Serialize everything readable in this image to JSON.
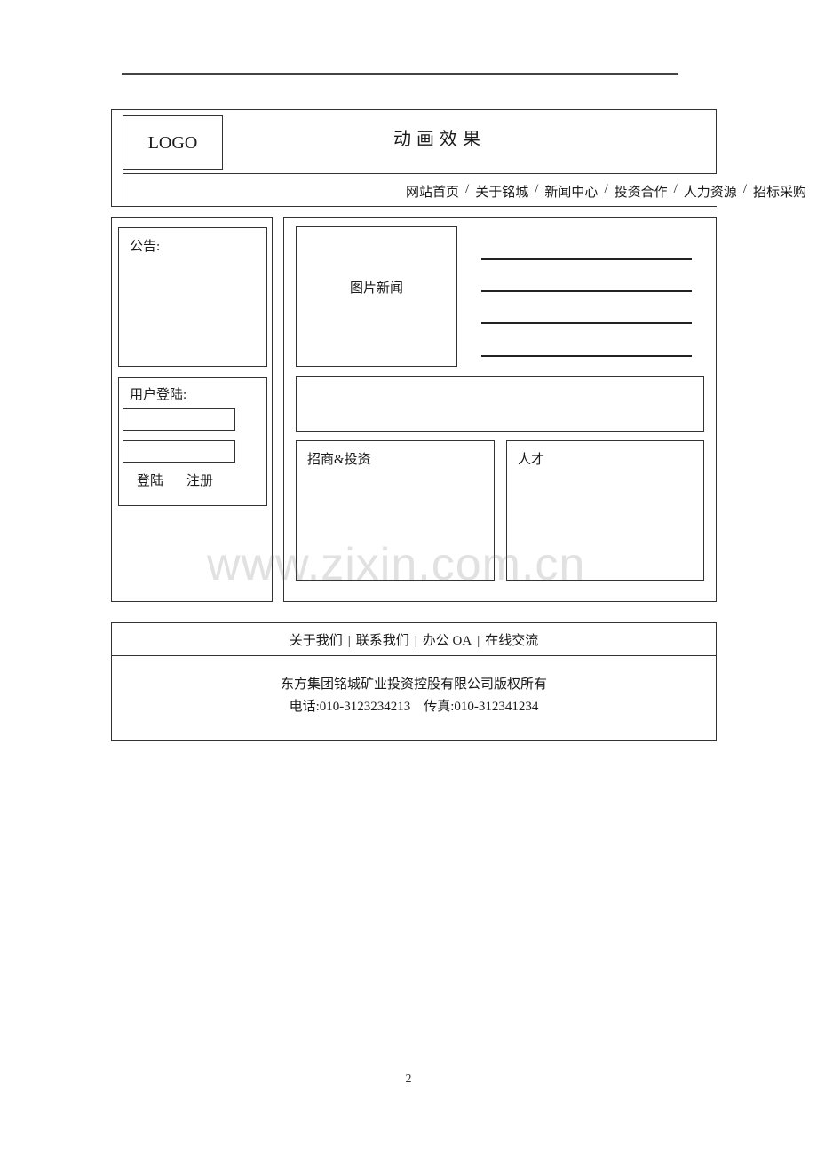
{
  "header": {
    "logo_text": "LOGO",
    "banner_title": "动画效果",
    "nav_items": [
      "网站首页",
      "关于铭城",
      "新闻中心",
      "投资合作",
      "人力资源",
      "招标采购"
    ],
    "nav_separator": "/"
  },
  "sidebar": {
    "notice_label": "公告:",
    "login_label": "用户登陆:",
    "username_value": "",
    "password_value": "",
    "login_button": "登陆",
    "register_button": "注册"
  },
  "main": {
    "photo_news_label": "图片新闻",
    "news_list_line_count": 4,
    "invest_label": "招商&投资",
    "talent_label": "人才"
  },
  "footer": {
    "links": [
      "关于我们",
      "联系我们",
      "办公 OA",
      "在线交流"
    ],
    "link_separator": "|",
    "copyright": "东方集团铭城矿业投资控股有限公司版权所有",
    "contact": "电话:010-3123234213    传真:010-312341234"
  },
  "watermark": "www.zixin.com.cn",
  "page_number": "2"
}
